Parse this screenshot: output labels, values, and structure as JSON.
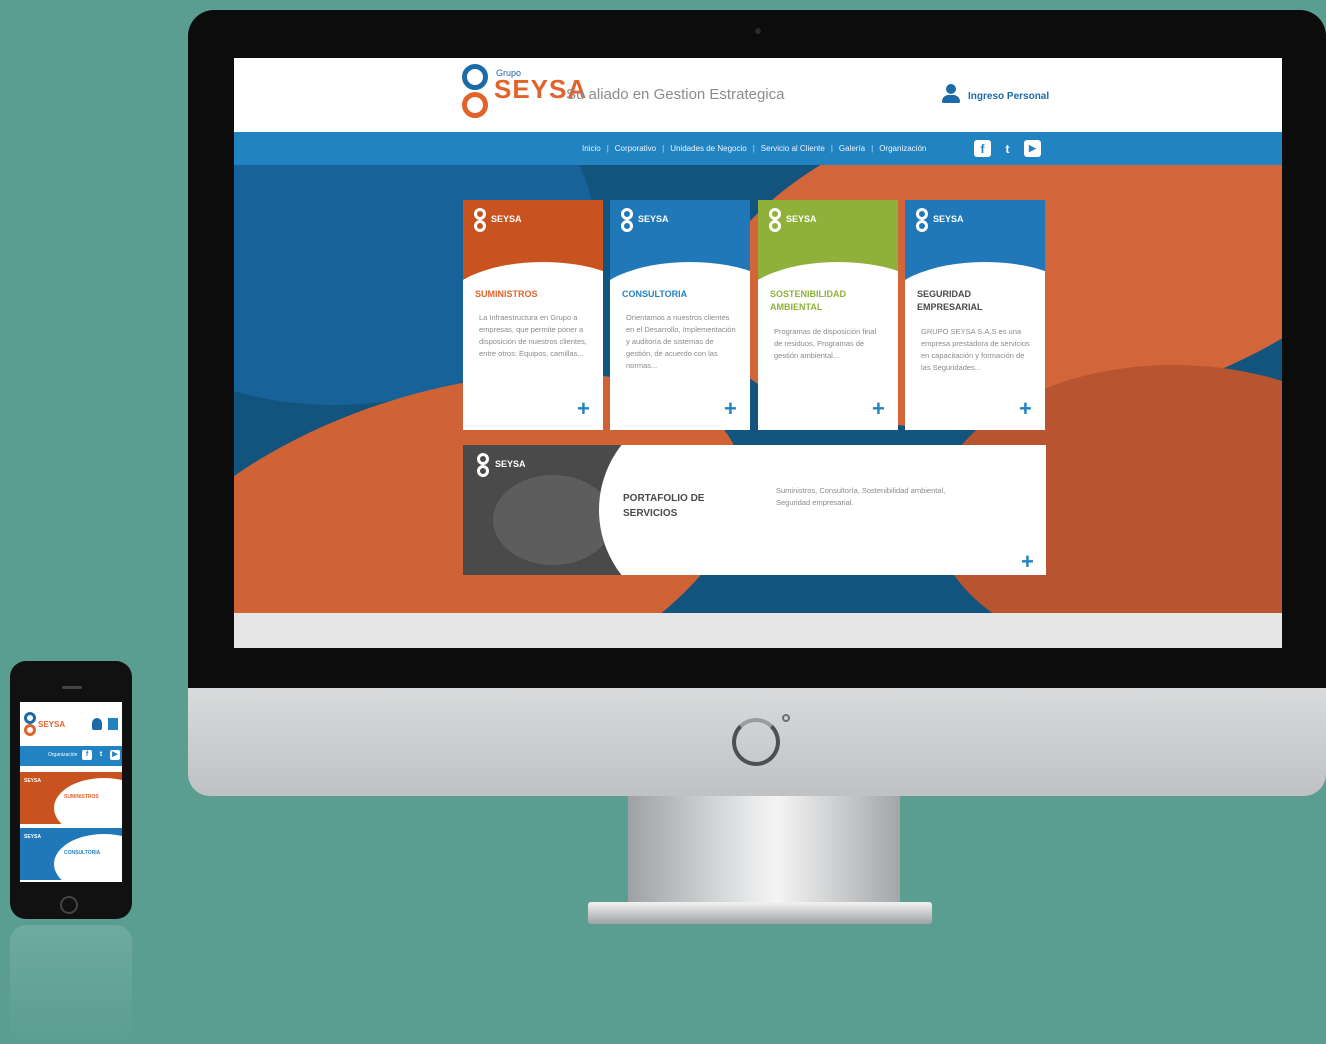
{
  "site": {
    "logo_word": "SEYSA",
    "logo_prefix": "Grupo",
    "tagline": "Su aliado en Gestion Estrategica",
    "login_label": "Ingreso Personal"
  },
  "nav": {
    "items": [
      "Inicio",
      "Corporativo",
      "Unidades de Negocio",
      "Servicio al Cliente",
      "Galería",
      "Organización"
    ],
    "social": [
      {
        "name": "facebook-icon",
        "glyph": "f"
      },
      {
        "name": "twitter-icon",
        "glyph": "t"
      },
      {
        "name": "youtube-icon",
        "glyph": "▶"
      }
    ]
  },
  "cards": [
    {
      "title": "SUMINISTROS",
      "color": "#c9531f",
      "title_color": "#e2622b",
      "text": "La Infraestructura en Grupo a empresas, que permite poner a disposición de nuestros clientes, entre otros: Equipos, camillas..."
    },
    {
      "title": "CONSULTORIA",
      "color": "#2178b8",
      "title_color": "#2283c3",
      "text": "Orientamos a nuestros clientes en el Desarrollo, Implementación y auditoría de sistemas de gestión, de acuerdo con las normas..."
    },
    {
      "title": "SOSTENIBILIDAD AMBIENTAL",
      "color": "#8fb13a",
      "title_color": "#8fb13a",
      "text": "Programas de disposición final de residuos, Programas de gestión ambiental..."
    },
    {
      "title": "SEGURIDAD EMPRESARIAL",
      "color": "#2178b8",
      "title_color": "#4a4a4a",
      "text": "GRUPO SEYSA S.A.S es una empresa prestadora de servicios en capacitación y formación de las Seguridades..."
    }
  ],
  "portfolio": {
    "title": "PORTAFOLIO DE SERVICIOS",
    "text": "Suministros, Consultoría, Sostenibilidad ambiental, Seguridad empresarial."
  },
  "phone": {
    "cards": [
      {
        "title": "SUMINISTROS",
        "color": "#c9531f",
        "title_color": "#e2622b"
      },
      {
        "title": "CONSULTORIA",
        "color": "#2178b8",
        "title_color": "#2283c3"
      }
    ]
  },
  "colors": {
    "background": "#5a9e92",
    "brand_blue": "#2283c3",
    "brand_orange": "#e2622b"
  }
}
